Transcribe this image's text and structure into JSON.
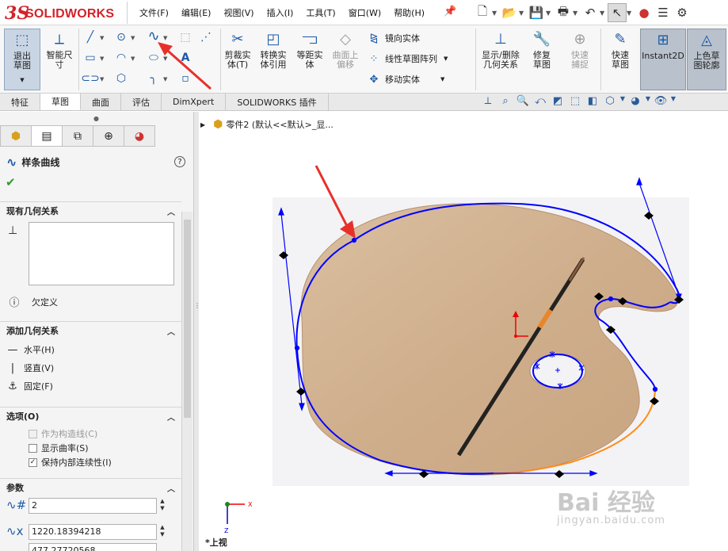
{
  "app": {
    "brand_ds": "3S",
    "brand_name": "SOLIDWORKS"
  },
  "menu": [
    "文件(F)",
    "编辑(E)",
    "视图(V)",
    "插入(I)",
    "工具(T)",
    "窗口(W)",
    "帮助(H)"
  ],
  "ribbon": {
    "exit_sketch": "退出草图",
    "smart_dimension": "智能尺寸",
    "trim": "剪裁实体(T)",
    "convert": "转换实体引用",
    "offset": "等距实体",
    "offset_surface": "曲面上偏移",
    "mirror": "镜向实体",
    "linear_pattern": "线性草图阵列",
    "move": "移动实体",
    "display_relations": "显示/删除几何关系",
    "repair": "修复草图",
    "quick_snaps": "快速捕捉",
    "rapid_sketch": "快速草图",
    "instant2d": "Instant2D",
    "shaded_contours": "上色草图轮廓"
  },
  "tabs": [
    "特征",
    "草图",
    "曲面",
    "评估",
    "DimXpert",
    "SOLIDWORKS 插件"
  ],
  "tree": {
    "part": "零件2 (默认<<默认>_显..."
  },
  "property_manager": {
    "title": "样条曲线",
    "existing_relations": "现有几何关系",
    "status": "欠定义",
    "add_relations": "添加几何关系",
    "horizontal": "水平(H)",
    "vertical": "竖直(V)",
    "fix": "固定(F)",
    "options": "选项(O)",
    "construction": "作为构造线(C)",
    "show_curvature": "显示曲率(S)",
    "keep_continuity": "保持内部连续性(I)",
    "parameters": "参数",
    "param1": "2",
    "param2": "1220.18394218",
    "param3": "477.27720568"
  },
  "viewport": {
    "view_label": "*上视",
    "axis_x": "X",
    "axis_y": "Y",
    "axis_z": "Z"
  },
  "watermark": {
    "main": "Bai 经验",
    "sub": "jingyan.baidu.com"
  },
  "colors": {
    "accent": "#1c5aa6",
    "spline": "#0000ff",
    "spline_selected": "#ff8c1a",
    "arrow": "#e8302a",
    "brand": "#d2232a"
  }
}
